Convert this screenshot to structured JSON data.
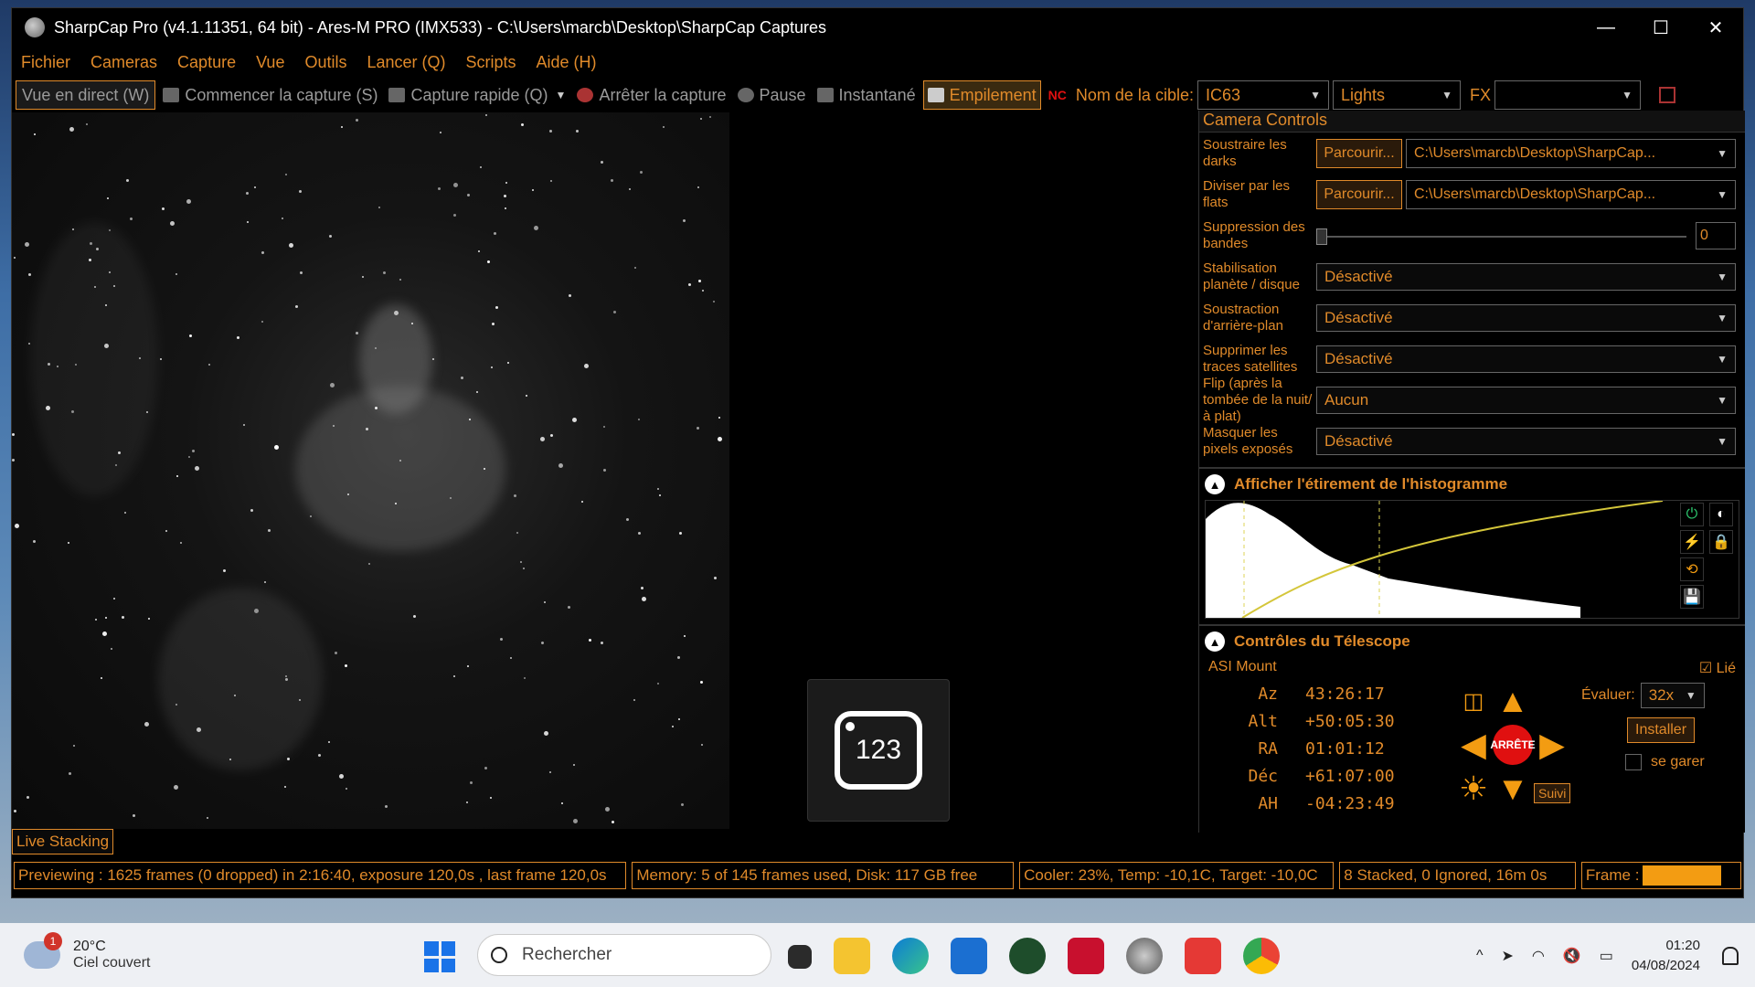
{
  "window": {
    "title": "SharpCap Pro (v4.1.11351, 64 bit) - Ares-M PRO (IMX533) - C:\\Users\\marcb\\Desktop\\SharpCap Captures",
    "minimize": "—",
    "maximize": "☐",
    "close": "✕"
  },
  "menu": [
    "Fichier",
    "Cameras",
    "Capture",
    "Vue",
    "Outils",
    "Lancer (Q)",
    "Scripts",
    "Aide (H)"
  ],
  "toolbar": {
    "live": "Vue en direct (W)",
    "start_capture": "Commencer la capture (S)",
    "quick_capture": "Capture rapide (Q)",
    "stop_capture": "Arrêter la capture",
    "pause": "Pause",
    "snapshot": "Instantané",
    "stacking": "Empilement",
    "target_label": "Nom de la cible:",
    "target_value": "IC63",
    "frame_type": "Lights",
    "fx_label": "FX",
    "fx_value": ""
  },
  "viewer": {
    "tile_text": "123"
  },
  "panel": {
    "header": "Camera Controls",
    "browse": "Parcourir...",
    "rows": [
      {
        "label": "Soustraire les darks",
        "path": "C:\\Users\\marcb\\Desktop\\SharpCap..."
      },
      {
        "label": "Diviser par les flats",
        "path": "C:\\Users\\marcb\\Desktop\\SharpCap..."
      }
    ],
    "banding": {
      "label": "Suppression des bandes",
      "value": "0"
    },
    "dropdowns": [
      {
        "label": "Stabilisation planète / disque",
        "value": "Désactivé"
      },
      {
        "label": "Soustraction d'arrière-plan",
        "value": "Désactivé"
      },
      {
        "label": "Supprimer les traces satellites",
        "value": "Désactivé"
      },
      {
        "label": "Flip (après la tombée de la nuit/à plat)",
        "value": "Aucun"
      },
      {
        "label": "Masquer les pixels exposés",
        "value": "Désactivé"
      }
    ],
    "histogram_title": "Afficher l'étirement de l'histogramme",
    "telescope_title": "Contrôles du Télescope",
    "mount": "ASI Mount",
    "linked": "Lié",
    "coords": [
      {
        "k": "Az",
        "v": "43:26:17"
      },
      {
        "k": "Alt",
        "v": "+50:05:30"
      },
      {
        "k": "RA",
        "v": "01:01:12"
      },
      {
        "k": "Déc",
        "v": "+61:07:00"
      },
      {
        "k": "AH",
        "v": "-04:23:49"
      }
    ],
    "evaluate_label": "Évaluer:",
    "evaluate_value": "32x",
    "install": "Installer",
    "park": "se garer",
    "stop": "ARRÊTE",
    "track": "Suivi"
  },
  "live_tab": "Live Stacking",
  "status": {
    "preview": "Previewing : 1625 frames (0 dropped) in 2:16:40, exposure 120,0s , last frame 120,0s",
    "memory": "Memory: 5 of 145 frames used, Disk: 117 GB free",
    "cooler": "Cooler: 23%, Temp: -10,1C, Target: -10,0C",
    "stack": "8 Stacked, 0 Ignored, 16m 0s",
    "frame": "Frame :"
  },
  "taskbar": {
    "weather_temp": "20°C",
    "weather_desc": "Ciel couvert",
    "weather_badge": "1",
    "search": "Rechercher",
    "time": "01:20",
    "date": "04/08/2024"
  },
  "colors": {
    "accent": "#e08a2a",
    "stop": "#e01010",
    "arrow": "#f39c12"
  }
}
